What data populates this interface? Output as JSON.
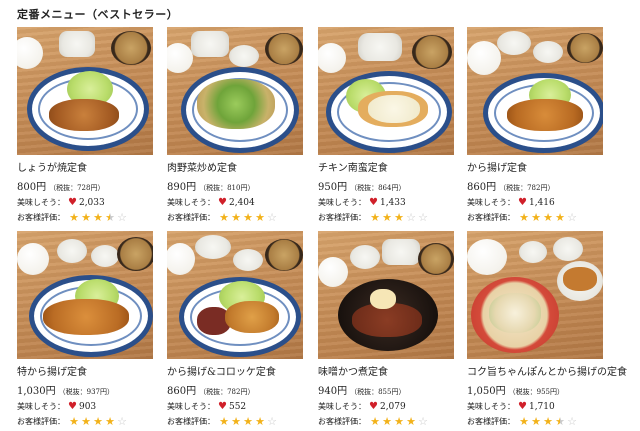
{
  "section": {
    "title": "定番メニュー（ベストセラー）"
  },
  "labels": {
    "tasty": "美味しそう：",
    "rating": "お客様評価：",
    "heart_icon": "heart-icon",
    "star_icon": "star-icon"
  },
  "colors": {
    "heart": "#d0202a",
    "star": "#f2b21a",
    "star_empty": "#c8c8c8",
    "plate_rim": "#2b4f8a"
  },
  "items": [
    {
      "name": "しょうが焼定食",
      "price": "800円",
      "tax": "（税抜：728円）",
      "likes": "2,033",
      "rating": 3.5
    },
    {
      "name": "肉野菜炒め定食",
      "price": "890円",
      "tax": "（税抜：810円）",
      "likes": "2,404",
      "rating": 4
    },
    {
      "name": "チキン南蛮定食",
      "price": "950円",
      "tax": "（税抜：864円）",
      "likes": "1,433",
      "rating": 3
    },
    {
      "name": "から揚げ定食",
      "price": "860円",
      "tax": "（税抜：782円）",
      "likes": "1,416",
      "rating": 4
    },
    {
      "name": "特から揚げ定食",
      "price": "1,030円",
      "tax": "（税抜：937円）",
      "likes": "903",
      "rating": 4
    },
    {
      "name": "から揚げ&コロッケ定食",
      "price": "860円",
      "tax": "（税抜：782円）",
      "likes": "552",
      "rating": 4
    },
    {
      "name": "味噌かつ煮定食",
      "price": "940円",
      "tax": "（税抜：855円）",
      "likes": "2,079",
      "rating": 4
    },
    {
      "name": "コク旨ちゃんぽんとから揚げの定食",
      "price": "1,050円",
      "tax": "（税抜：955円）",
      "likes": "1,710",
      "rating": 3.5
    }
  ]
}
